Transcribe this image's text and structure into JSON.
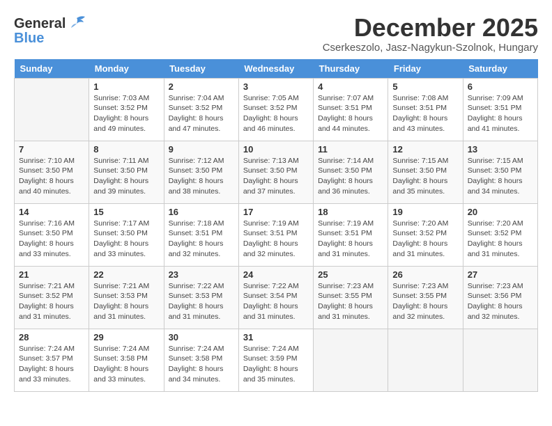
{
  "logo": {
    "line1": "General",
    "line2": "Blue"
  },
  "title": "December 2025",
  "subtitle": "Cserkeszolo, Jasz-Nagykun-Szolnok, Hungary",
  "days_header": [
    "Sunday",
    "Monday",
    "Tuesday",
    "Wednesday",
    "Thursday",
    "Friday",
    "Saturday"
  ],
  "weeks": [
    [
      {
        "day": "",
        "info": ""
      },
      {
        "day": "1",
        "info": "Sunrise: 7:03 AM\nSunset: 3:52 PM\nDaylight: 8 hours\nand 49 minutes."
      },
      {
        "day": "2",
        "info": "Sunrise: 7:04 AM\nSunset: 3:52 PM\nDaylight: 8 hours\nand 47 minutes."
      },
      {
        "day": "3",
        "info": "Sunrise: 7:05 AM\nSunset: 3:52 PM\nDaylight: 8 hours\nand 46 minutes."
      },
      {
        "day": "4",
        "info": "Sunrise: 7:07 AM\nSunset: 3:51 PM\nDaylight: 8 hours\nand 44 minutes."
      },
      {
        "day": "5",
        "info": "Sunrise: 7:08 AM\nSunset: 3:51 PM\nDaylight: 8 hours\nand 43 minutes."
      },
      {
        "day": "6",
        "info": "Sunrise: 7:09 AM\nSunset: 3:51 PM\nDaylight: 8 hours\nand 41 minutes."
      }
    ],
    [
      {
        "day": "7",
        "info": "Sunrise: 7:10 AM\nSunset: 3:50 PM\nDaylight: 8 hours\nand 40 minutes."
      },
      {
        "day": "8",
        "info": "Sunrise: 7:11 AM\nSunset: 3:50 PM\nDaylight: 8 hours\nand 39 minutes."
      },
      {
        "day": "9",
        "info": "Sunrise: 7:12 AM\nSunset: 3:50 PM\nDaylight: 8 hours\nand 38 minutes."
      },
      {
        "day": "10",
        "info": "Sunrise: 7:13 AM\nSunset: 3:50 PM\nDaylight: 8 hours\nand 37 minutes."
      },
      {
        "day": "11",
        "info": "Sunrise: 7:14 AM\nSunset: 3:50 PM\nDaylight: 8 hours\nand 36 minutes."
      },
      {
        "day": "12",
        "info": "Sunrise: 7:15 AM\nSunset: 3:50 PM\nDaylight: 8 hours\nand 35 minutes."
      },
      {
        "day": "13",
        "info": "Sunrise: 7:15 AM\nSunset: 3:50 PM\nDaylight: 8 hours\nand 34 minutes."
      }
    ],
    [
      {
        "day": "14",
        "info": "Sunrise: 7:16 AM\nSunset: 3:50 PM\nDaylight: 8 hours\nand 33 minutes."
      },
      {
        "day": "15",
        "info": "Sunrise: 7:17 AM\nSunset: 3:50 PM\nDaylight: 8 hours\nand 33 minutes."
      },
      {
        "day": "16",
        "info": "Sunrise: 7:18 AM\nSunset: 3:51 PM\nDaylight: 8 hours\nand 32 minutes."
      },
      {
        "day": "17",
        "info": "Sunrise: 7:19 AM\nSunset: 3:51 PM\nDaylight: 8 hours\nand 32 minutes."
      },
      {
        "day": "18",
        "info": "Sunrise: 7:19 AM\nSunset: 3:51 PM\nDaylight: 8 hours\nand 31 minutes."
      },
      {
        "day": "19",
        "info": "Sunrise: 7:20 AM\nSunset: 3:52 PM\nDaylight: 8 hours\nand 31 minutes."
      },
      {
        "day": "20",
        "info": "Sunrise: 7:20 AM\nSunset: 3:52 PM\nDaylight: 8 hours\nand 31 minutes."
      }
    ],
    [
      {
        "day": "21",
        "info": "Sunrise: 7:21 AM\nSunset: 3:52 PM\nDaylight: 8 hours\nand 31 minutes."
      },
      {
        "day": "22",
        "info": "Sunrise: 7:21 AM\nSunset: 3:53 PM\nDaylight: 8 hours\nand 31 minutes."
      },
      {
        "day": "23",
        "info": "Sunrise: 7:22 AM\nSunset: 3:53 PM\nDaylight: 8 hours\nand 31 minutes."
      },
      {
        "day": "24",
        "info": "Sunrise: 7:22 AM\nSunset: 3:54 PM\nDaylight: 8 hours\nand 31 minutes."
      },
      {
        "day": "25",
        "info": "Sunrise: 7:23 AM\nSunset: 3:55 PM\nDaylight: 8 hours\nand 31 minutes."
      },
      {
        "day": "26",
        "info": "Sunrise: 7:23 AM\nSunset: 3:55 PM\nDaylight: 8 hours\nand 32 minutes."
      },
      {
        "day": "27",
        "info": "Sunrise: 7:23 AM\nSunset: 3:56 PM\nDaylight: 8 hours\nand 32 minutes."
      }
    ],
    [
      {
        "day": "28",
        "info": "Sunrise: 7:24 AM\nSunset: 3:57 PM\nDaylight: 8 hours\nand 33 minutes."
      },
      {
        "day": "29",
        "info": "Sunrise: 7:24 AM\nSunset: 3:58 PM\nDaylight: 8 hours\nand 33 minutes."
      },
      {
        "day": "30",
        "info": "Sunrise: 7:24 AM\nSunset: 3:58 PM\nDaylight: 8 hours\nand 34 minutes."
      },
      {
        "day": "31",
        "info": "Sunrise: 7:24 AM\nSunset: 3:59 PM\nDaylight: 8 hours\nand 35 minutes."
      },
      {
        "day": "",
        "info": ""
      },
      {
        "day": "",
        "info": ""
      },
      {
        "day": "",
        "info": ""
      }
    ]
  ]
}
